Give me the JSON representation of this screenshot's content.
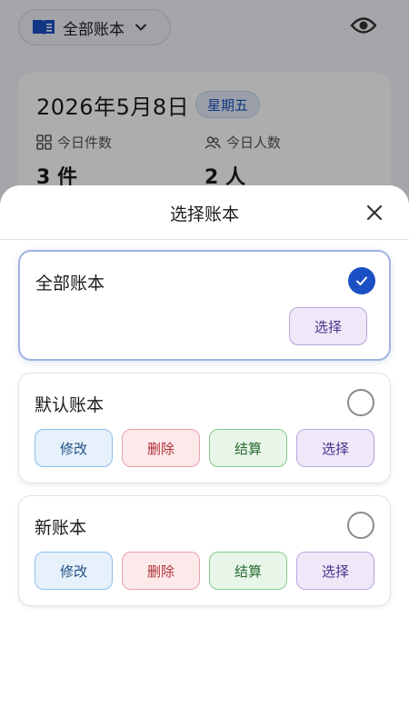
{
  "topbar": {
    "book_selector_label": "全部账本"
  },
  "stats": {
    "date": "2026年5月8日",
    "weekday": "星期五",
    "items_label": "今日件数",
    "items_value": "3 件",
    "people_label": "今日人数",
    "people_value": "2 人"
  },
  "sheet": {
    "title": "选择账本",
    "books": [
      {
        "name": "全部账本",
        "selected": true,
        "actions": [
          "选择"
        ]
      },
      {
        "name": "默认账本",
        "selected": false,
        "actions": [
          "修改",
          "删除",
          "结算",
          "选择"
        ]
      },
      {
        "name": "新账本",
        "selected": false,
        "actions": [
          "修改",
          "删除",
          "结算",
          "选择"
        ]
      }
    ]
  },
  "colors": {
    "accent": "#1d4fc4",
    "edit": "#e6f1fc",
    "delete": "#fde9ea",
    "settle": "#e8f6e9",
    "select": "#efe8f8"
  },
  "icons": [
    "book-icon",
    "chevron-down-icon",
    "eye-icon",
    "grid-icon",
    "people-icon",
    "close-icon",
    "check-icon"
  ]
}
